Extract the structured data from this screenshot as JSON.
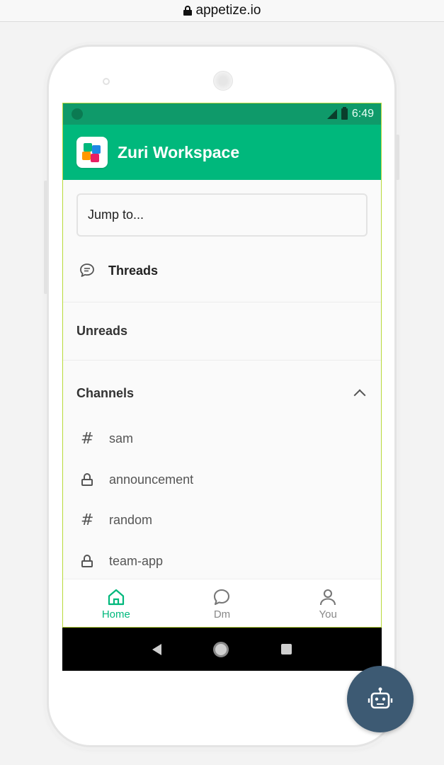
{
  "browser": {
    "url": "appetize.io"
  },
  "status_bar": {
    "time": "6:49",
    "network": "LTE"
  },
  "app_bar": {
    "title": "Zuri Workspace"
  },
  "search": {
    "placeholder": "Jump to..."
  },
  "threads": {
    "label": "Threads"
  },
  "unreads": {
    "label": "Unreads"
  },
  "channels": {
    "header": "Channels",
    "items": [
      {
        "label": "sam",
        "icon": "hash-icon"
      },
      {
        "label": "announcement",
        "icon": "lock-icon"
      },
      {
        "label": "random",
        "icon": "hash-icon"
      },
      {
        "label": "team-app",
        "icon": "lock-icon"
      }
    ]
  },
  "bottom_nav": {
    "items": [
      {
        "label": "Home",
        "icon": "home-icon",
        "active": true
      },
      {
        "label": "Dm",
        "icon": "chat-bubble-icon",
        "active": false
      },
      {
        "label": "You",
        "icon": "person-icon",
        "active": false
      }
    ]
  },
  "colors": {
    "accent": "#00b87c",
    "status_bar": "#0f9a6a",
    "fab": "#3d5a73"
  },
  "fab": {
    "icon": "robot-icon"
  }
}
